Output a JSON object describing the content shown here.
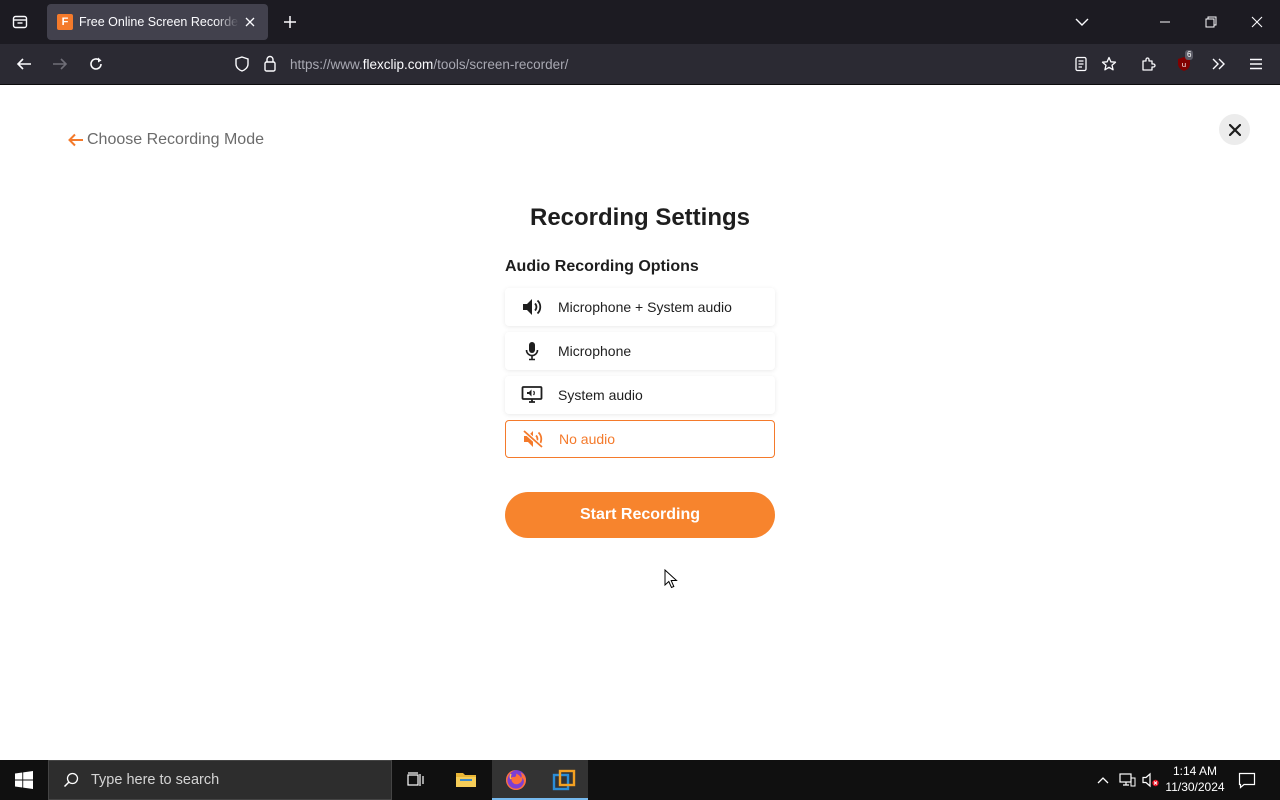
{
  "browser": {
    "tab_title": "Free Online Screen Recorder & Webcam Recorder",
    "favicon_letter": "F",
    "url_prefix": "https://www.",
    "url_host": "flexclip.com",
    "url_path": "/tools/screen-recorder/",
    "extension_badge": "6"
  },
  "dialog": {
    "back_label": "Choose Recording Mode",
    "title": "Recording Settings",
    "section_label": "Audio Recording Options",
    "options": [
      {
        "label": "Microphone + System audio",
        "icon": "speaker-icon",
        "selected": false
      },
      {
        "label": "Microphone",
        "icon": "microphone-icon",
        "selected": false
      },
      {
        "label": "System audio",
        "icon": "monitor-speaker-icon",
        "selected": false
      },
      {
        "label": "No audio",
        "icon": "muted-icon",
        "selected": true
      }
    ],
    "start_label": "Start Recording"
  },
  "taskbar": {
    "search_placeholder": "Type here to search",
    "time": "1:14 AM",
    "date": "11/30/2024"
  },
  "colors": {
    "accent": "#f7842d",
    "tab_bg": "#42414d",
    "toolbar_bg": "#2b2a33",
    "tabbar_bg": "#1c1b22"
  }
}
